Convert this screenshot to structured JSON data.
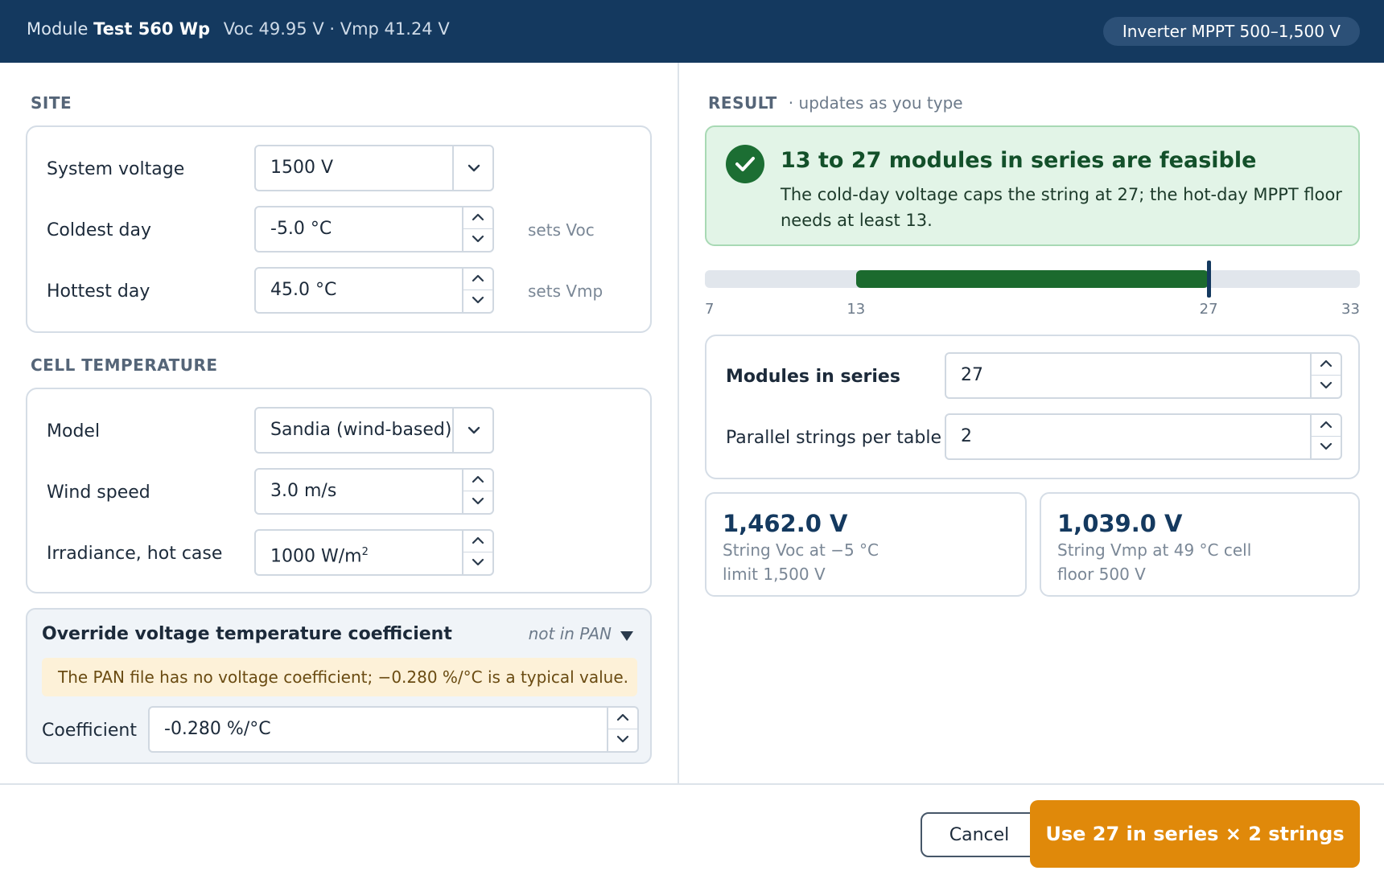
{
  "header": {
    "module_prefix": "Module",
    "module_name": "Test 560 Wp",
    "module_specs": "Voc 49.95 V · Vmp 41.24 V",
    "inverter": "Inverter MPPT 500–1,500 V"
  },
  "site": {
    "title": "SITE",
    "system_voltage": {
      "label": "System voltage",
      "value": "1500 V"
    },
    "coldest_day": {
      "label": "Coldest day",
      "value": "-5.0 °C",
      "hint": "sets Voc"
    },
    "hottest_day": {
      "label": "Hottest day",
      "value": "45.0 °C",
      "hint": "sets Vmp"
    }
  },
  "cell_temperature": {
    "title": "CELL TEMPERATURE",
    "model": {
      "label": "Model",
      "value": "Sandia (wind-based)"
    },
    "wind_speed": {
      "label": "Wind speed",
      "value": "3.0 m/s"
    },
    "irradiance": {
      "label": "Irradiance, hot case",
      "value": "1000 W/m",
      "unit_sup": "2"
    }
  },
  "override": {
    "title": "Override voltage temperature coefficient",
    "status": "not in PAN",
    "warning": "The PAN file has no voltage coefficient; −0.280 %/°C is a typical value.",
    "coefficient_label": "Coefficient",
    "coefficient_value": "-0.280 %/°C"
  },
  "result": {
    "title": "RESULT",
    "subtitle": "· updates as you type",
    "headline": "13 to 27 modules in series are feasible",
    "body": "The cold-day voltage caps the string at 27; the hot-day MPPT floor needs at least 13.",
    "range": {
      "min": 7,
      "max": 33,
      "feasible_min": 13,
      "feasible_max": 27,
      "selected": 27
    },
    "ticks": [
      "7",
      "13",
      "27",
      "33"
    ],
    "modules_in_series": {
      "label": "Modules in series",
      "value": "27"
    },
    "parallel_strings": {
      "label": "Parallel strings per table",
      "value": "2"
    },
    "voc_stat": {
      "value": "1,462.0 V",
      "line1": "String Voc at −5 °C",
      "line2": "limit 1,500 V"
    },
    "vmp_stat": {
      "value": "1,039.0 V",
      "line1": "String Vmp at 49 °C cell",
      "line2": "floor 500 V"
    }
  },
  "footer": {
    "cancel_label": "Cancel",
    "apply_label": "Use 27 in series × 2 strings"
  },
  "colors": {
    "header_bg": "#14395f",
    "accent_orange": "#e0890a",
    "success_green": "#1b6a2e",
    "success_bg": "#e2f4e7"
  }
}
